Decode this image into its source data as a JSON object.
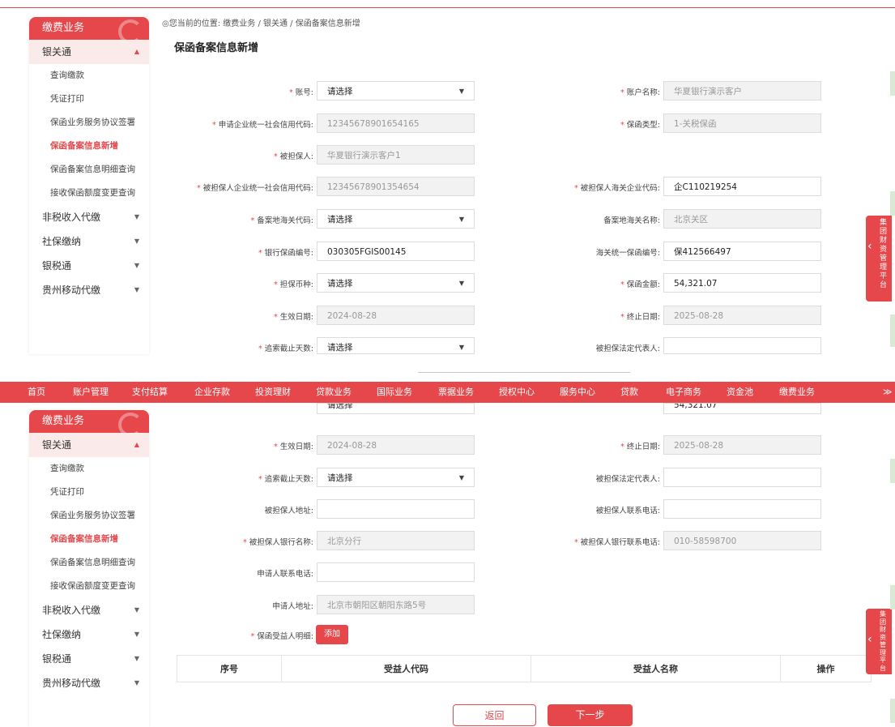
{
  "colors": {
    "accent": "#e5474b",
    "disabled_bg": "#f2f2f2"
  },
  "breadcrumb": "您当前的位置: 缴费业务 / 银关通 / 保函备案信息新增",
  "page_title": "保函备案信息新增",
  "sidebar": {
    "title": "缴费业务",
    "groups": [
      "银关通",
      "非税收入代缴",
      "社保缴纳",
      "银税通",
      "贵州移动代缴"
    ],
    "subitems": [
      "查询缴款",
      "凭证打印",
      "保函业务服务协议签署",
      "保函备案信息新增",
      "保函备案信息明细查询",
      "接收保函额度变更查询"
    ]
  },
  "form": {
    "account": {
      "label": "账号:",
      "value": "请选择"
    },
    "account_name": {
      "label": "账户名称:",
      "value": "华夏银行演示客户"
    },
    "applicant_credit_code": {
      "label": "申请企业统一社会信用代码:",
      "value": "12345678901654165"
    },
    "guarantee_type": {
      "label": "保函类型:",
      "value": "1-关税保函"
    },
    "guaranteed_party": {
      "label": "被担保人:",
      "value": "华夏银行演示客户1"
    },
    "guaranteed_credit_code": {
      "label": "被担保人企业统一社会信用代码:",
      "value": "12345678901354654"
    },
    "guaranteed_customs_code": {
      "label": "被担保人海关企业代码:",
      "value": "企C110219254"
    },
    "filing_customs_code": {
      "label": "备案地海关代码:",
      "value": "请选择"
    },
    "filing_customs_name": {
      "label": "备案地海关名称:",
      "value": "北京关区"
    },
    "bank_guarantee_no": {
      "label": "银行保函编号:",
      "value": "030305FGIS00145"
    },
    "customs_unified_no": {
      "label": "海关统一保函编号:",
      "value": "保412566497"
    },
    "currency": {
      "label": "担保币种:",
      "value": "请选择"
    },
    "amount": {
      "label": "保函金额:",
      "value": "54,321.07"
    },
    "effective_date": {
      "label": "生效日期:",
      "value": "2024-08-28"
    },
    "end_date": {
      "label": "终止日期:",
      "value": "2025-08-28"
    },
    "claim_days": {
      "label": "追索截止天数:",
      "value": "请选择"
    },
    "legal_rep": {
      "label": "被担保法定代表人:",
      "value": ""
    },
    "guaranteed_address": {
      "label": "被担保人地址:",
      "value": ""
    },
    "guaranteed_phone": {
      "label": "被担保人联系电话:",
      "value": ""
    },
    "guaranteed_bank_name": {
      "label": "被担保人银行名称:",
      "value": "北京分行"
    },
    "guaranteed_bank_phone": {
      "label": "被担保人银行联系电话:",
      "value": "010-58598700"
    },
    "applicant_phone": {
      "label": "申请人联系电话:",
      "value": ""
    },
    "applicant_address": {
      "label": "申请人地址:",
      "value": "北京市朝阳区朝阳东路5号"
    },
    "beneficiary": {
      "label": "保函受益人明细:",
      "add_label": "添加"
    }
  },
  "partial_top": {
    "currency_value": "请选择",
    "amount_value": "54,321.07"
  },
  "table": {
    "headers": [
      "序号",
      "受益人代码",
      "受益人名称",
      "操作"
    ]
  },
  "nav": [
    "首页",
    "账户管理",
    "支付结算",
    "企业存款",
    "投资理财",
    "贷款业务",
    "国际业务",
    "票据业务",
    "授权中心",
    "服务中心",
    "贷款",
    "电子商务",
    "资金池",
    "缴费业务"
  ],
  "nav_more": "≫",
  "right_panel": {
    "text": "集团财资管理平台",
    "chevron": "‹"
  },
  "buttons": {
    "back": "返回",
    "next": "下一步"
  }
}
